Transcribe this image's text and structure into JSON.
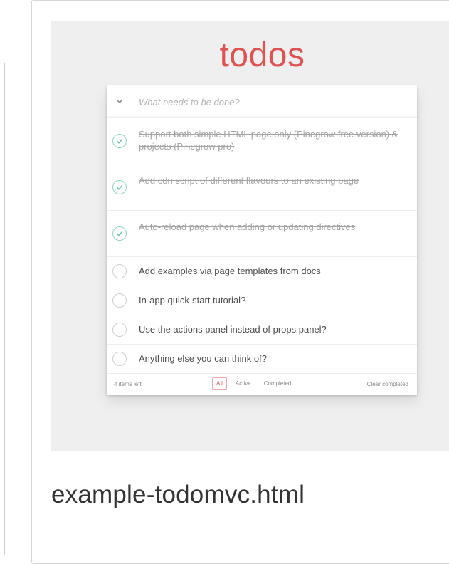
{
  "app": {
    "title": "todos",
    "new_todo_placeholder": "What needs to be done?",
    "toggle_all_icon": "chevron-down-icon",
    "accent_color": "#db3a3a",
    "check_color": "#5dc2af"
  },
  "todos": [
    {
      "text": "Support both simple HTML page only (Pinegrow free version) & projects (Pinegrow pro)",
      "completed": true
    },
    {
      "text": "Add cdn script of different flavours to an existing page",
      "completed": true
    },
    {
      "text": "Auto-reload page when adding or updating directives",
      "completed": true
    },
    {
      "text": "Add examples via page templates from docs",
      "completed": false
    },
    {
      "text": "In-app quick-start tutorial?",
      "completed": false
    },
    {
      "text": "Use the actions panel instead of props panel?",
      "completed": false
    },
    {
      "text": "Anything else you can think of?",
      "completed": false
    }
  ],
  "footer": {
    "items_left": "4 items left",
    "filters": [
      "All",
      "Active",
      "Completed"
    ],
    "selected_filter": "All",
    "clear_completed": "Clear completed"
  },
  "file": {
    "name": "example-todomvc.html"
  }
}
